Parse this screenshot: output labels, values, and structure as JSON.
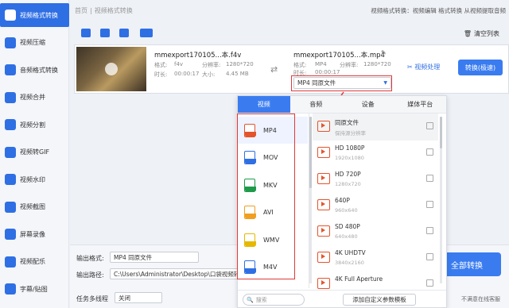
{
  "colors": {
    "accent": "#2f6fe4",
    "highlight": "#e03a3a",
    "file_icon_mp4": "#e4542b"
  },
  "sidebar": {
    "items": [
      {
        "label": "视频格式转换",
        "icon": "video-convert-icon",
        "active": true
      },
      {
        "label": "视频压缩",
        "icon": "compress-icon"
      },
      {
        "label": "音频格式转换",
        "icon": "audio-icon"
      },
      {
        "label": "视频合并",
        "icon": "merge-icon"
      },
      {
        "label": "视频分割",
        "icon": "split-icon"
      },
      {
        "label": "视频转GIF",
        "icon": "gif-icon"
      },
      {
        "label": "视频水印",
        "icon": "watermark-icon"
      },
      {
        "label": "视频截图",
        "icon": "screenshot-icon"
      },
      {
        "label": "屏幕录像",
        "icon": "record-icon"
      },
      {
        "label": "视频配乐",
        "icon": "music-icon"
      },
      {
        "label": "字幕/贴图",
        "icon": "subtitle-icon"
      }
    ]
  },
  "titlebar": {
    "home": "首页",
    "current": "视频格式转换",
    "right_text": "视频格式转换：视频编辑 格式转换 从视频提取音频"
  },
  "toolbar": {
    "clear_label": "清空列表"
  },
  "file": {
    "source_name": "mmexport170105...本.f4v",
    "source_format_label": "格式:",
    "source_format": "f4v",
    "source_res_label": "分辨率:",
    "source_res": "1280*720",
    "source_duration_label": "时长:",
    "source_duration": "00:00:17",
    "source_size_label": "大小:",
    "source_size": "4.45 MB",
    "dest_name": "mmexport170105...本.mp4",
    "dest_format_label": "格式:",
    "dest_format": "MP4",
    "dest_res_label": "分辨率:",
    "dest_res": "1280*720",
    "dest_duration_label": "时长:",
    "dest_duration": "00:00:17",
    "format_select": "MP4  同原文件",
    "video_process": "视频处理",
    "convert_btn": "转换(极速)"
  },
  "dropdown": {
    "tabs": [
      "视频",
      "音频",
      "设备",
      "媒体平台"
    ],
    "formats": [
      {
        "name": "MP4",
        "color": "#e4542b"
      },
      {
        "name": "MOV",
        "color": "#2f6fe4"
      },
      {
        "name": "MKV",
        "color": "#1f9a4b"
      },
      {
        "name": "AVI",
        "color": "#f0a020"
      },
      {
        "name": "WMV",
        "color": "#e6b800"
      },
      {
        "name": "M4V",
        "color": "#2f6fe4"
      }
    ],
    "presets": [
      {
        "title": "同原文件",
        "sub": "保持源分辨率"
      },
      {
        "title": "HD 1080P",
        "sub": "1920x1080"
      },
      {
        "title": "HD 720P",
        "sub": "1280x720"
      },
      {
        "title": "640P",
        "sub": "960x640"
      },
      {
        "title": "SD 480P",
        "sub": "640x480"
      },
      {
        "title": "4K UHDTV",
        "sub": "3840x2160"
      },
      {
        "title": "4K Full Aperture",
        "sub": ""
      }
    ],
    "search_placeholder": "搜索",
    "add_preset": "添加自定义参数模板"
  },
  "bottom": {
    "output_format_label": "输出格式:",
    "output_format": "MP4  同原文件",
    "output_path_label": "输出路径:",
    "output_path": "C:\\Users\\Administrator\\Desktop\\口袋视频转换",
    "task_label": "任务多线程",
    "task_value": "关闭",
    "all_convert": "全部转换",
    "footer_right": "不满意在线客服"
  }
}
